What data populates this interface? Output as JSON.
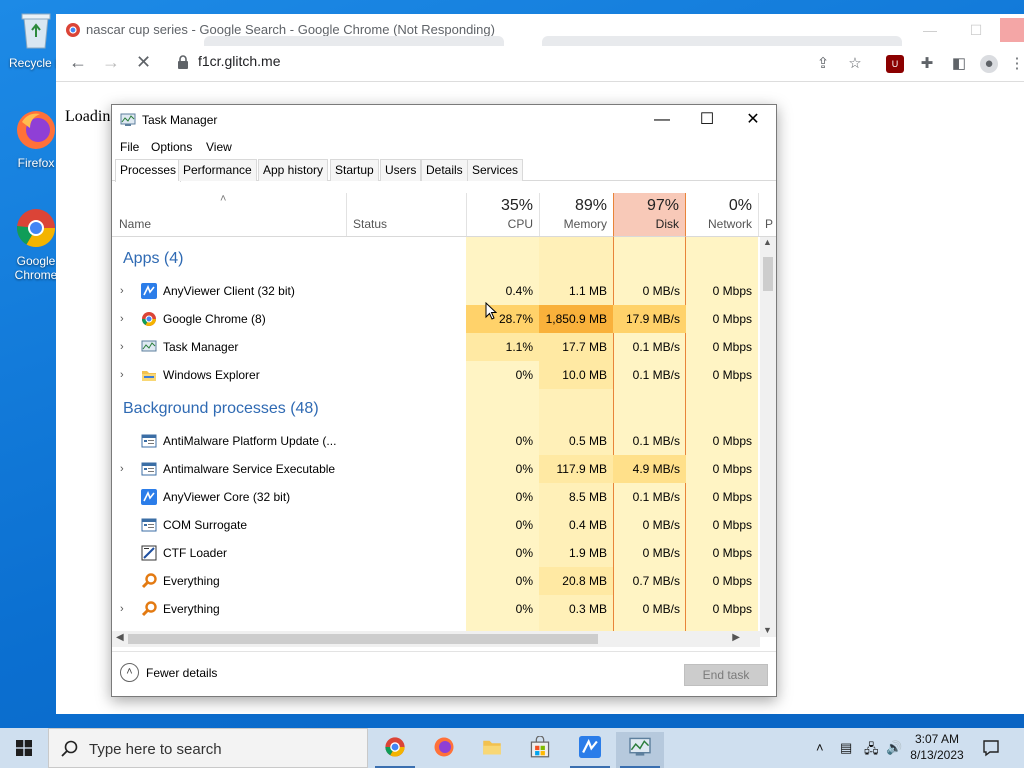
{
  "desktop": {
    "icons": [
      {
        "label": "Recycle B"
      },
      {
        "label": "Firefox"
      },
      {
        "label": "Google Chrome"
      }
    ]
  },
  "chrome": {
    "window_title": "nascar cup series - Google Search - Google Chrome (Not Responding)",
    "url": "f1cr.glitch.me",
    "page_text": "Loadin"
  },
  "task_manager": {
    "title": "Task Manager",
    "menu": [
      "File",
      "Options",
      "View"
    ],
    "tabs": [
      "Processes",
      "Performance",
      "App history",
      "Startup",
      "Users",
      "Details",
      "Services"
    ],
    "active_tab": "Processes",
    "columns": {
      "name": "Name",
      "status": "Status",
      "cpu": {
        "pct": "35%",
        "label": "CPU"
      },
      "memory": {
        "pct": "89%",
        "label": "Memory"
      },
      "disk": {
        "pct": "97%",
        "label": "Disk"
      },
      "network": {
        "pct": "0%",
        "label": "Network"
      },
      "power": "P"
    },
    "groups": {
      "apps": "Apps (4)",
      "background": "Background processes (48)"
    },
    "apps": [
      {
        "name": "AnyViewer Client (32 bit)",
        "cpu": "0.4%",
        "memory": "1.1 MB",
        "disk": "0 MB/s",
        "network": "0 Mbps"
      },
      {
        "name": "Google Chrome (8)",
        "cpu": "28.7%",
        "memory": "1,850.9 MB",
        "disk": "17.9 MB/s",
        "network": "0 Mbps"
      },
      {
        "name": "Task Manager",
        "cpu": "1.1%",
        "memory": "17.7 MB",
        "disk": "0.1 MB/s",
        "network": "0 Mbps"
      },
      {
        "name": "Windows Explorer",
        "cpu": "0%",
        "memory": "10.0 MB",
        "disk": "0.1 MB/s",
        "network": "0 Mbps"
      }
    ],
    "background": [
      {
        "name": "AntiMalware Platform Update (...",
        "cpu": "0%",
        "memory": "0.5 MB",
        "disk": "0.1 MB/s",
        "network": "0 Mbps"
      },
      {
        "name": "Antimalware Service Executable",
        "cpu": "0%",
        "memory": "117.9 MB",
        "disk": "4.9 MB/s",
        "network": "0 Mbps"
      },
      {
        "name": "AnyViewer Core (32 bit)",
        "cpu": "0%",
        "memory": "8.5 MB",
        "disk": "0.1 MB/s",
        "network": "0 Mbps"
      },
      {
        "name": "COM Surrogate",
        "cpu": "0%",
        "memory": "0.4 MB",
        "disk": "0 MB/s",
        "network": "0 Mbps"
      },
      {
        "name": "CTF Loader",
        "cpu": "0%",
        "memory": "1.9 MB",
        "disk": "0 MB/s",
        "network": "0 Mbps"
      },
      {
        "name": "Everything",
        "cpu": "0%",
        "memory": "20.8 MB",
        "disk": "0.7 MB/s",
        "network": "0 Mbps"
      },
      {
        "name": "Everything",
        "cpu": "0%",
        "memory": "0.3 MB",
        "disk": "0 MB/s",
        "network": "0 Mbps"
      }
    ],
    "footer": {
      "fewer_details": "Fewer details",
      "end_task": "End task"
    }
  },
  "taskbar": {
    "search_placeholder": "Type here to search",
    "time": "3:07 AM",
    "date": "8/13/2023"
  },
  "colors": {
    "heat_light": "#fff4c4",
    "heat_mid": "#ffe9a3",
    "heat_high": "#ffd26a",
    "heat_hot": "#f9b13b",
    "disk_header": "#f8c9b8",
    "group_text": "#2f6ab3"
  }
}
